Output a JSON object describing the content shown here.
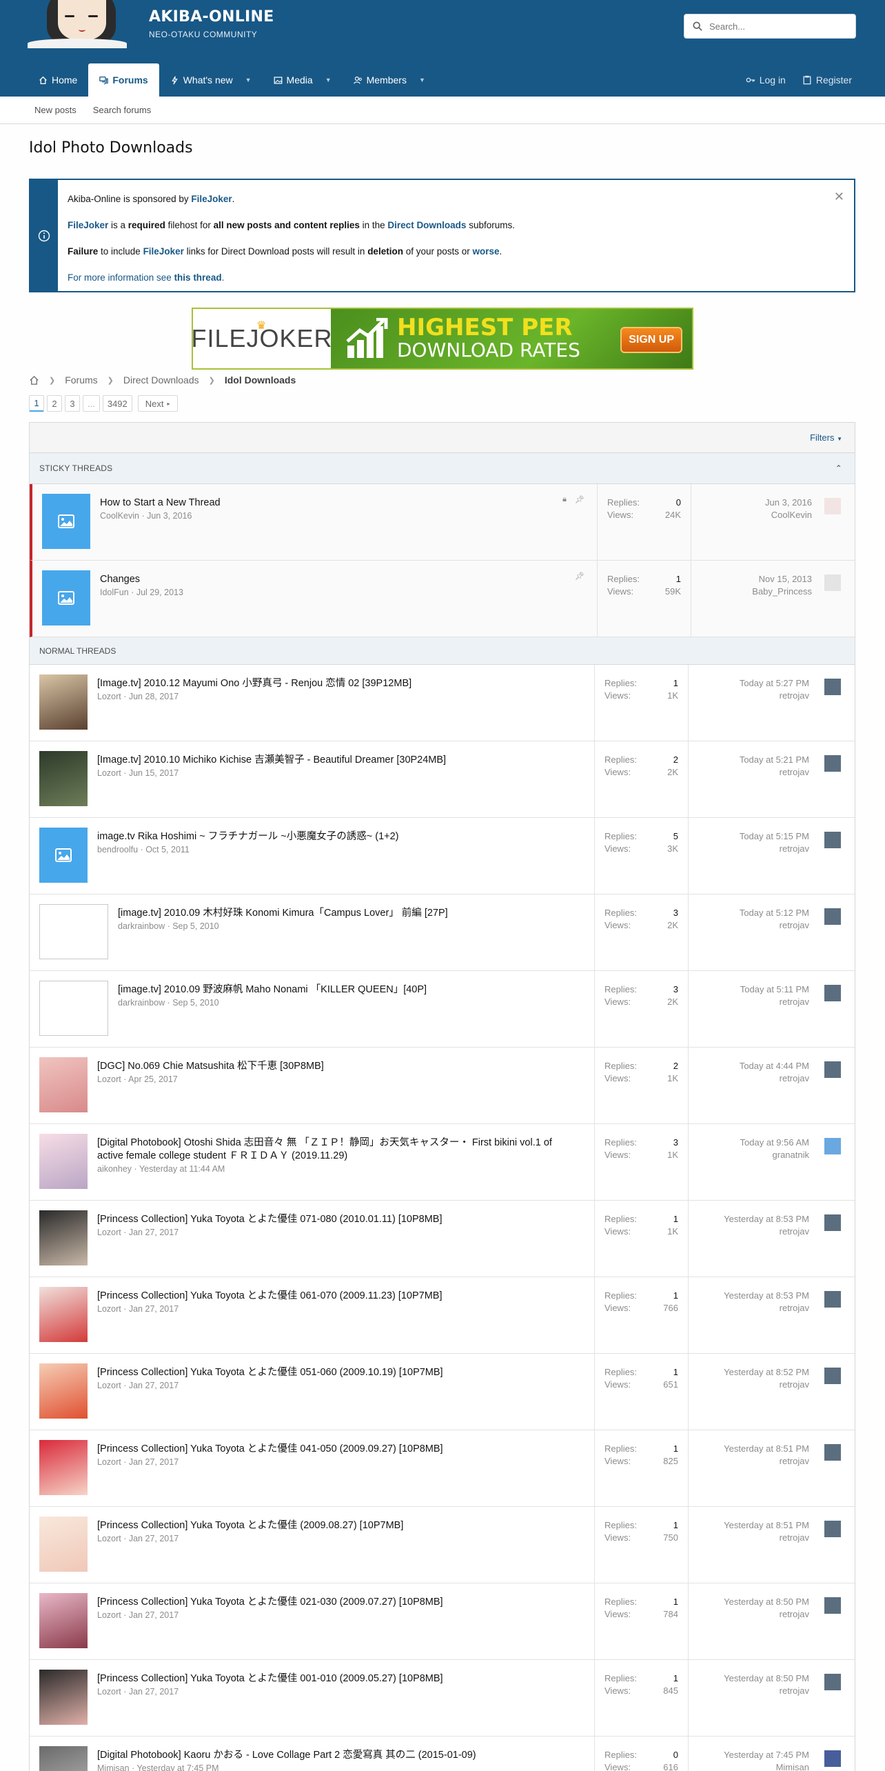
{
  "site": {
    "title": "AKIBA-ONLINE",
    "subtitle": "NEO-OTAKU COMMUNITY"
  },
  "search": {
    "placeholder": "Search..."
  },
  "nav": {
    "home": "Home",
    "forums": "Forums",
    "whats_new": "What's new",
    "media": "Media",
    "members": "Members",
    "login": "Log in",
    "register": "Register"
  },
  "subnav": {
    "new_posts": "New posts",
    "search_forums": "Search forums"
  },
  "page_title": "Idol Photo Downloads",
  "notice": {
    "line1_a": "Akiba-Online is sponsored by ",
    "line1_b": "FileJoker",
    "line1_c": ".",
    "line2_a": "FileJoker",
    "line2_b": " is a ",
    "line2_c": "required",
    "line2_d": " filehost for ",
    "line2_e": "all new posts and content replies",
    "line2_f": " in the ",
    "line2_g": "Direct Downloads",
    "line2_h": " subforums.",
    "line3_a": "Failure",
    "line3_b": " to include ",
    "line3_c": "FileJoker",
    "line3_d": " links for Direct Download posts will result in ",
    "line3_e": "deletion",
    "line3_f": " of your posts or ",
    "line3_g": "worse",
    "line3_h": ".",
    "line4_a": "For more information see ",
    "line4_b": "this thread",
    "line4_c": "."
  },
  "banner": {
    "brand": "FILEJOKER",
    "headline1": "HIGHEST PER",
    "headline2": "DOWNLOAD RATES",
    "cta": "SIGN UP"
  },
  "breadcrumb": {
    "forums": "Forums",
    "direct": "Direct Downloads",
    "current": "Idol Downloads"
  },
  "pager": {
    "p1": "1",
    "p2": "2",
    "p3": "3",
    "ellipsis": "...",
    "last": "3492",
    "next": "Next"
  },
  "filters": "Filters",
  "sticky_header": "Sticky threads",
  "normal_header": "NORMAL THREADS",
  "labels": {
    "replies": "Replies:",
    "views": "Views:"
  },
  "colors": {
    "header": "#185886",
    "accent": "#47a7eb",
    "sticky_bar": "#c1272d"
  },
  "sticky": [
    {
      "title": "How to Start a New Thread",
      "author": "CoolKevin",
      "date": "Jun 3, 2016",
      "replies": "0",
      "views": "24K",
      "last_date": "Jun 3, 2016",
      "last_user": "CoolKevin"
    },
    {
      "title": "Changes",
      "author": "IdolFun",
      "date": "Jul 29, 2013",
      "replies": "1",
      "views": "59K",
      "last_date": "Nov 15, 2013",
      "last_user": "Baby_Princess"
    }
  ],
  "threads": [
    {
      "title": "[Image.tv] 2010.12 Mayumi Ono 小野真弓 - Renjou 恋情 02 [39P12MB]",
      "author": "Lozort",
      "date": "Jun 28, 2017",
      "replies": "1",
      "views": "1K",
      "last_date": "Today at 5:27 PM",
      "last_user": "retrojav"
    },
    {
      "title": "[Image.tv] 2010.10 Michiko Kichise 吉瀬美智子 - Beautiful Dreamer [30P24MB]",
      "author": "Lozort",
      "date": "Jun 15, 2017",
      "replies": "2",
      "views": "2K",
      "last_date": "Today at 5:21 PM",
      "last_user": "retrojav"
    },
    {
      "title": "image.tv Rika Hoshimi ~ フラチナガール ~小悪魔女子の誘惑~ (1+2)",
      "author": "bendroolfu",
      "date": "Oct 5, 2011",
      "replies": "5",
      "views": "3K",
      "last_date": "Today at 5:15 PM",
      "last_user": "retrojav"
    },
    {
      "title": "[image.tv] 2010.09 木村好珠 Konomi Kimura「Campus Lover」 前編 [27P]",
      "author": "darkrainbow",
      "date": "Sep 5, 2010",
      "replies": "3",
      "views": "2K",
      "last_date": "Today at 5:12 PM",
      "last_user": "retrojav"
    },
    {
      "title": "[image.tv] 2010.09 野波麻帆 Maho Nonami 「KILLER QUEEN」[40P]",
      "author": "darkrainbow",
      "date": "Sep 5, 2010",
      "replies": "3",
      "views": "2K",
      "last_date": "Today at 5:11 PM",
      "last_user": "retrojav"
    },
    {
      "title": "[DGC] No.069 Chie Matsushita 松下千恵 [30P8MB]",
      "author": "Lozort",
      "date": "Apr 25, 2017",
      "replies": "2",
      "views": "1K",
      "last_date": "Today at 4:44 PM",
      "last_user": "retrojav"
    },
    {
      "title": "[Digital Photobook] Otoshi Shida 志田音々 無 「ＺＩＰ！静岡」お天気キャスター・ First bikini vol.1 of active female college student ＦＲＩＤＡＹ (2019.11.29)",
      "author": "aikonhey",
      "date": "Yesterday at 11:44 AM",
      "replies": "3",
      "views": "1K",
      "last_date": "Today at 9:56 AM",
      "last_user": "granatnik"
    },
    {
      "title": "[Princess Collection] Yuka Toyota とよた優佳 071-080 (2010.01.11) [10P8MB]",
      "author": "Lozort",
      "date": "Jan 27, 2017",
      "replies": "1",
      "views": "1K",
      "last_date": "Yesterday at 8:53 PM",
      "last_user": "retrojav"
    },
    {
      "title": "[Princess Collection] Yuka Toyota とよた優佳 061-070 (2009.11.23) [10P7MB]",
      "author": "Lozort",
      "date": "Jan 27, 2017",
      "replies": "1",
      "views": "766",
      "last_date": "Yesterday at 8:53 PM",
      "last_user": "retrojav"
    },
    {
      "title": "[Princess Collection] Yuka Toyota とよた優佳 051-060 (2009.10.19) [10P7MB]",
      "author": "Lozort",
      "date": "Jan 27, 2017",
      "replies": "1",
      "views": "651",
      "last_date": "Yesterday at 8:52 PM",
      "last_user": "retrojav"
    },
    {
      "title": "[Princess Collection] Yuka Toyota とよた優佳 041-050 (2009.09.27) [10P8MB]",
      "author": "Lozort",
      "date": "Jan 27, 2017",
      "replies": "1",
      "views": "825",
      "last_date": "Yesterday at 8:51 PM",
      "last_user": "retrojav"
    },
    {
      "title": "[Princess Collection] Yuka Toyota とよた優佳 (2009.08.27) [10P7MB]",
      "author": "Lozort",
      "date": "Jan 27, 2017",
      "replies": "1",
      "views": "750",
      "last_date": "Yesterday at 8:51 PM",
      "last_user": "retrojav"
    },
    {
      "title": "[Princess Collection] Yuka Toyota とよた優佳 021-030 (2009.07.27) [10P8MB]",
      "author": "Lozort",
      "date": "Jan 27, 2017",
      "replies": "1",
      "views": "784",
      "last_date": "Yesterday at 8:50 PM",
      "last_user": "retrojav"
    },
    {
      "title": "[Princess Collection] Yuka Toyota とよた優佳 001-010 (2009.05.27) [10P8MB]",
      "author": "Lozort",
      "date": "Jan 27, 2017",
      "replies": "1",
      "views": "845",
      "last_date": "Yesterday at 8:50 PM",
      "last_user": "retrojav"
    },
    {
      "title": "[Digital Photobook] Kaoru かおる - Love Collage Part 2 恋愛寫真 其の二 (2015-01-09)",
      "author": "Mimisan",
      "date": "Yesterday at 7:45 PM",
      "replies": "0",
      "views": "616",
      "last_date": "Yesterday at 7:45 PM",
      "last_user": "Mimisan"
    }
  ]
}
